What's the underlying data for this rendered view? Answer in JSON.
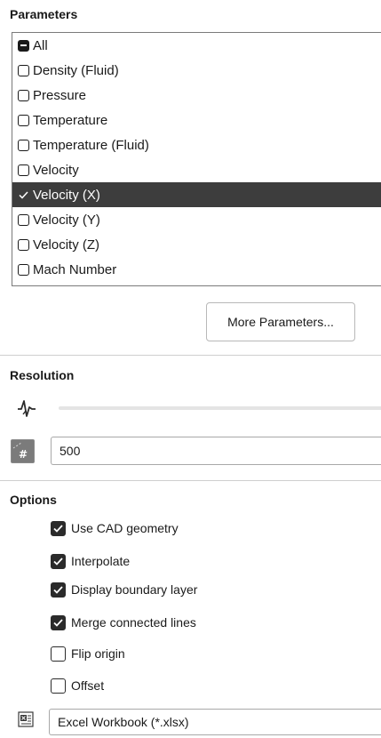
{
  "parameters": {
    "title": "Parameters",
    "items": [
      {
        "label": "All",
        "state": "indeterminate"
      },
      {
        "label": "Density (Fluid)",
        "state": "unchecked"
      },
      {
        "label": "Pressure",
        "state": "unchecked"
      },
      {
        "label": "Temperature",
        "state": "unchecked"
      },
      {
        "label": "Temperature (Fluid)",
        "state": "unchecked"
      },
      {
        "label": "Velocity",
        "state": "unchecked"
      },
      {
        "label": "Velocity (X)",
        "state": "checked",
        "selected": true
      },
      {
        "label": "Velocity (Y)",
        "state": "unchecked"
      },
      {
        "label": "Velocity (Z)",
        "state": "unchecked"
      },
      {
        "label": "Mach Number",
        "state": "unchecked"
      }
    ],
    "more_button_label": "More Parameters..."
  },
  "resolution": {
    "title": "Resolution",
    "slider_icon": "waveform-icon",
    "points_icon": "points-count-icon",
    "value": "500"
  },
  "options": {
    "title": "Options",
    "items": [
      {
        "label": "Use CAD geometry",
        "checked": true
      },
      {
        "label": "Interpolate",
        "checked": true
      },
      {
        "label": "Display boundary layer",
        "checked": true
      },
      {
        "label": "Merge connected lines",
        "checked": true
      },
      {
        "label": "Flip origin",
        "checked": false
      },
      {
        "label": "Offset",
        "checked": false
      }
    ]
  },
  "export": {
    "icon": "excel-file-icon",
    "format": "Excel Workbook (*.xlsx)"
  },
  "colors": {
    "selected_bg": "#3d3d3d",
    "checkbox_fill": "#2b2b2b",
    "divider": "#cfcfcf"
  }
}
